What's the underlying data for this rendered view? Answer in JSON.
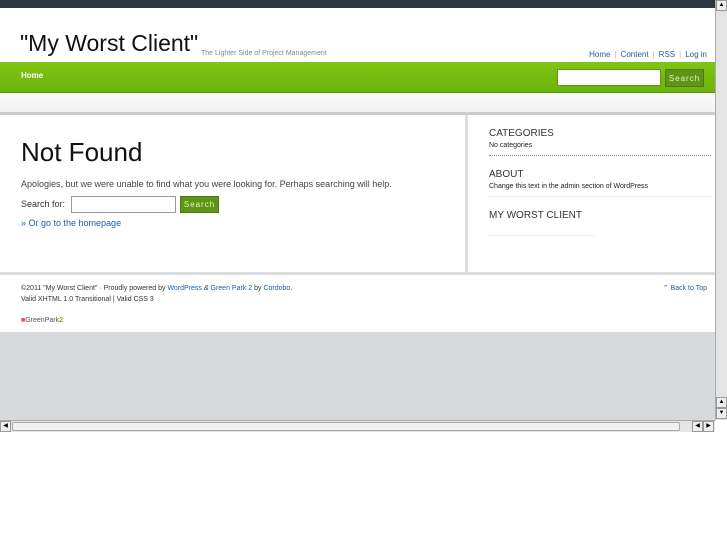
{
  "header": {
    "title": "\"My Worst Client\"",
    "tagline": "The Lighter Side of Project Management",
    "links": [
      "Home",
      "Content",
      "RSS",
      "Log in"
    ]
  },
  "nav": {
    "home": "Home",
    "search_button": "Search"
  },
  "main": {
    "heading": "Not Found",
    "message": "Apologies, but we were unable to find what you were looking for. Perhaps searching will help.",
    "search_label": "Search for:",
    "search_button": "Search",
    "homepage_link": "» Or go to the homepage"
  },
  "sidebar": [
    {
      "title": "CATEGORIES",
      "text": "No categories"
    },
    {
      "title": "ABOUT",
      "text": "Change this text in the admin section of WordPress"
    },
    {
      "title": "MY WORST CLIENT"
    }
  ],
  "footer": {
    "copyright": "©2011 \"My Worst Client\" · Proudly powered by",
    "wordpress": "WordPress",
    "amp": "&",
    "greenpark": "Green Park 2",
    "by": "by",
    "cordobo": "Cordobo.",
    "valid": "Valid XHTML 1.0 Transitional | Valid CSS 3",
    "back_to_top": "⌃ Back to Top",
    "logo": "GreenPark",
    "logo_num": "2"
  }
}
